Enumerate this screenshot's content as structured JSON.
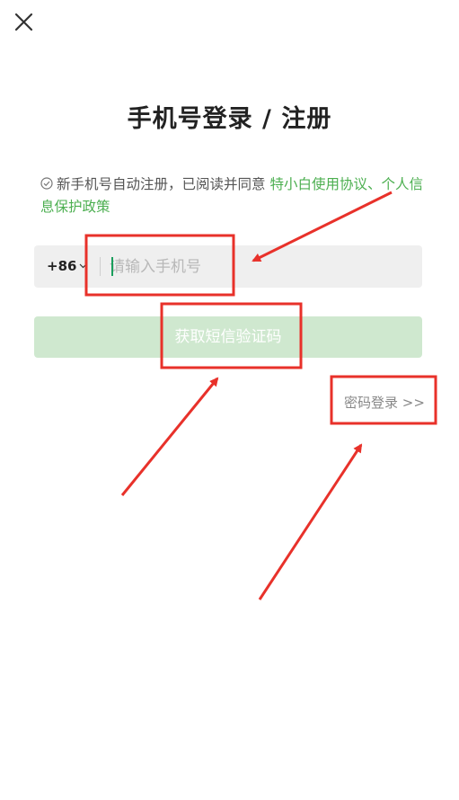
{
  "header": {
    "close_icon": "close-icon"
  },
  "title": "手机号登录 / 注册",
  "agreement": {
    "check_icon": "check-circle-icon",
    "prefix": "新手机号自动注册，已阅读并同意 ",
    "user_agreement": "特小白使用协议",
    "separator": "、",
    "privacy_policy": "个人信息保护政策"
  },
  "phone": {
    "country_code": "+86",
    "placeholder": "请输入手机号",
    "value": ""
  },
  "sms_button": {
    "label": "获取短信验证码"
  },
  "password_login": {
    "label": "密码登录 >>"
  },
  "colors": {
    "accent": "#4caf50",
    "button_disabled": "#cfe8cf",
    "annotation": "#e8312a"
  }
}
